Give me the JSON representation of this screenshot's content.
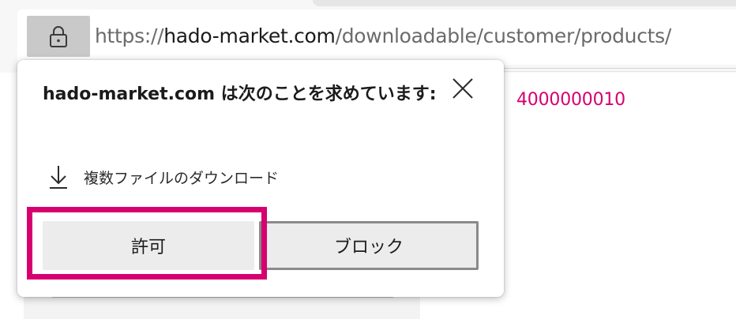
{
  "address_bar": {
    "url_scheme": "https://",
    "url_domain": "hado-market.com",
    "url_path": "/downloadable/customer/products/",
    "lock_icon": "lock-icon"
  },
  "page": {
    "order_number": "4000000010"
  },
  "permission_popup": {
    "title": "hado-market.com は次のことを求めています:",
    "close_icon": "close-icon",
    "permission_icon": "download-icon",
    "permission_label": "複数ファイルのダウンロード",
    "allow_label": "許可",
    "block_label": "ブロック"
  },
  "colors": {
    "highlight": "#d6006f",
    "order_number": "#d6006f"
  }
}
